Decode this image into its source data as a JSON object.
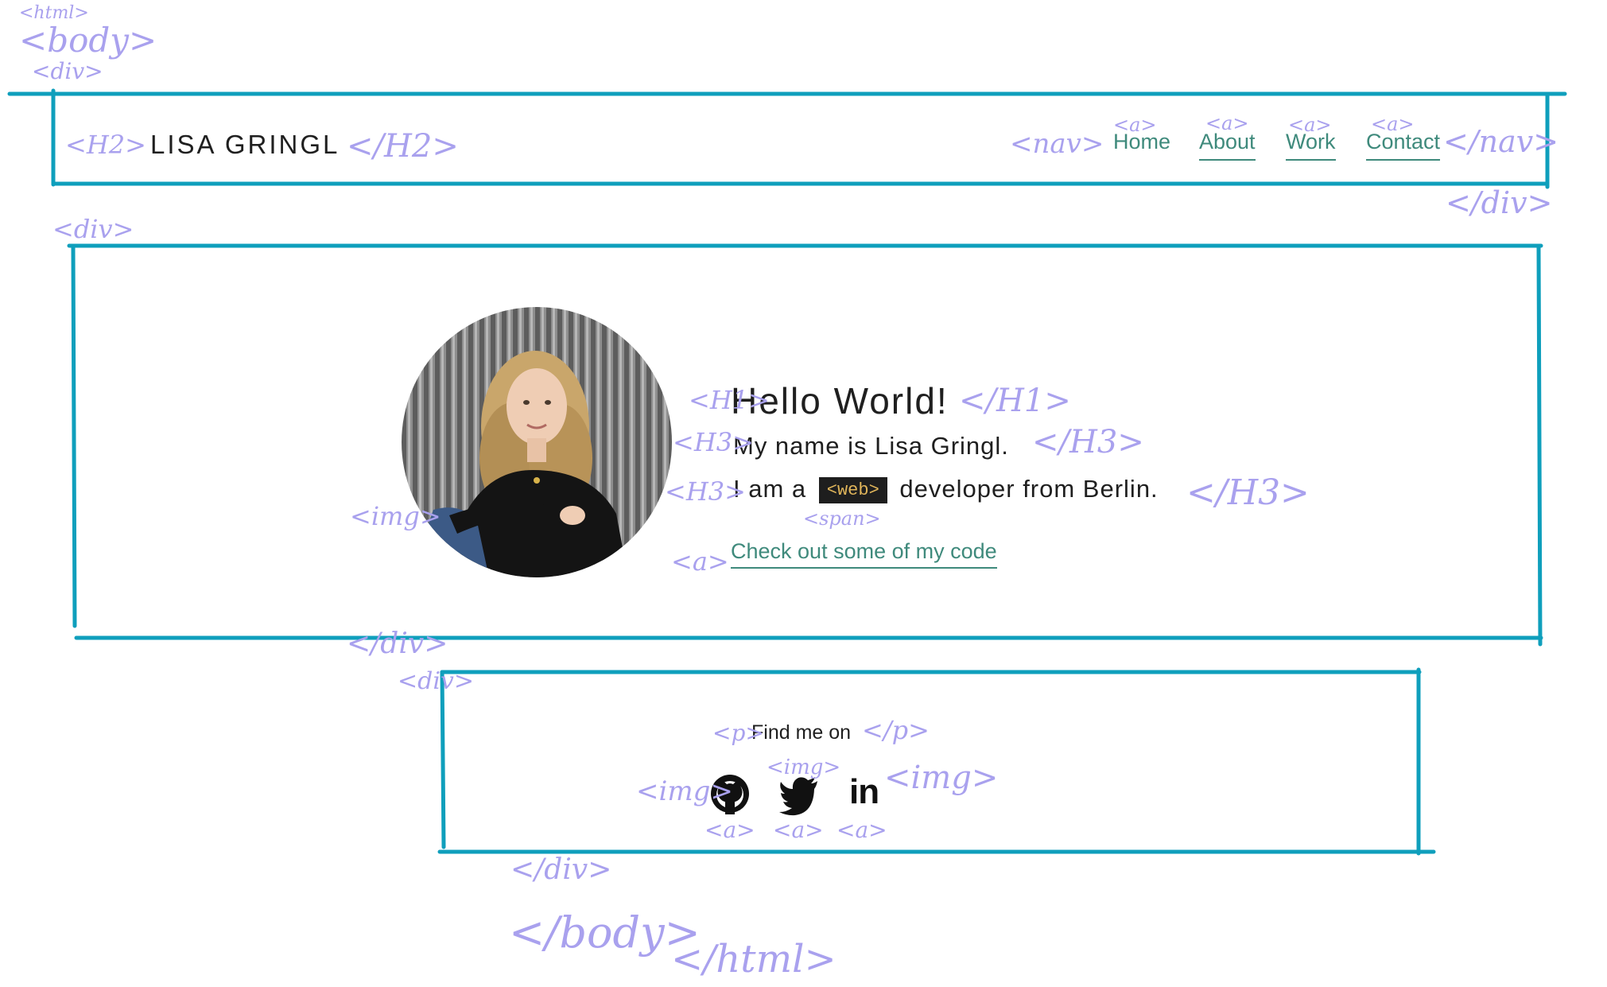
{
  "colors": {
    "box": "#0f9fbc",
    "annotation": "#a9a1ee",
    "link": "#3f8a7c",
    "tag_bg": "#1e1e1e",
    "tag_text": "#e0b55a"
  },
  "page": {
    "brand": "LISA GRINGL",
    "nav": [
      "Home",
      "About",
      "Work",
      "Contact"
    ],
    "hero": {
      "title": "Hello World!",
      "name_line": "My name is Lisa Gringl.",
      "role_prefix": "I am a",
      "role_tag": "<web>",
      "role_suffix": "developer from Berlin.",
      "code_link": "Check out some of my code"
    },
    "footer": {
      "label": "Find me on",
      "icons": [
        "github-icon",
        "twitter-icon",
        "linkedin-icon"
      ],
      "linkedin_text": "in"
    }
  },
  "annotations": {
    "html_open": "<html>",
    "body_open": "<body>",
    "div_open_top": "<div>",
    "h2_open": "<H2>",
    "h2_close": "</H2>",
    "nav_open": "<nav>",
    "nav_close": "</nav>",
    "a_home": "<a>",
    "a_about": "<a>",
    "a_work": "<a>",
    "a_contact": "<a>",
    "div_close_header": "</div>",
    "div_open_hero": "<div>",
    "h1_open": "<H1>",
    "h1_close": "</H1>",
    "h3_open_1": "<H3>",
    "h3_close_1": "</H3>",
    "h3_open_2": "<H3>",
    "h3_close_2": "</H3>",
    "span": "<span>",
    "img_photo": "<img>",
    "a_code": "<a>",
    "div_close_hero": "</div>",
    "div_open_footer": "<div>",
    "p_open": "<p>",
    "p_close": "</p>",
    "img_github": "<img>",
    "img_twitter": "<img>",
    "img_linkedin": "<img>",
    "a_github": "<a>",
    "a_twitter": "<a>",
    "a_linkedin": "<a>",
    "div_close_footer": "</div>",
    "body_close": "</body>",
    "html_close": "</html>"
  }
}
